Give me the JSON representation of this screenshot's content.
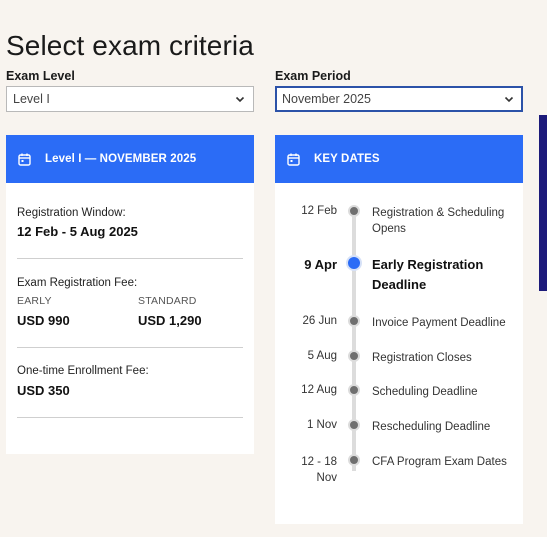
{
  "page": {
    "title": "Select exam criteria"
  },
  "filters": {
    "level": {
      "label": "Exam Level",
      "value": "Level I"
    },
    "period": {
      "label": "Exam Period",
      "value": "November 2025"
    }
  },
  "summary_card": {
    "heading": "Level I — NOVEMBER 2025",
    "registration_window_label": "Registration Window:",
    "registration_window_value": "12 Feb - 5 Aug 2025",
    "fee_label": "Exam Registration Fee:",
    "early_label": "EARLY",
    "early_value": "USD 990",
    "standard_label": "STANDARD",
    "standard_value": "USD 1,290",
    "enrollment_label": "One-time Enrollment Fee:",
    "enrollment_value": "USD 350"
  },
  "key_dates": {
    "heading": "KEY DATES",
    "items": [
      {
        "date": "12 Feb",
        "text": "Registration & Scheduling Opens"
      },
      {
        "date": "9 Apr",
        "text": "Early Registration Deadline",
        "highlight": true
      },
      {
        "date": "26 Jun",
        "text": "Invoice Payment Deadline"
      },
      {
        "date": "5 Aug",
        "text": "Registration Closes"
      },
      {
        "date": "12 Aug",
        "text": "Scheduling Deadline"
      },
      {
        "date": "1 Nov",
        "text": "Rescheduling Deadline"
      },
      {
        "date": "12 - 18 Nov",
        "text": "CFA Program Exam Dates"
      }
    ]
  },
  "colors": {
    "accent": "#2b6cf6",
    "background": "#f8f4ef",
    "side_accent": "#1c1a7a"
  }
}
